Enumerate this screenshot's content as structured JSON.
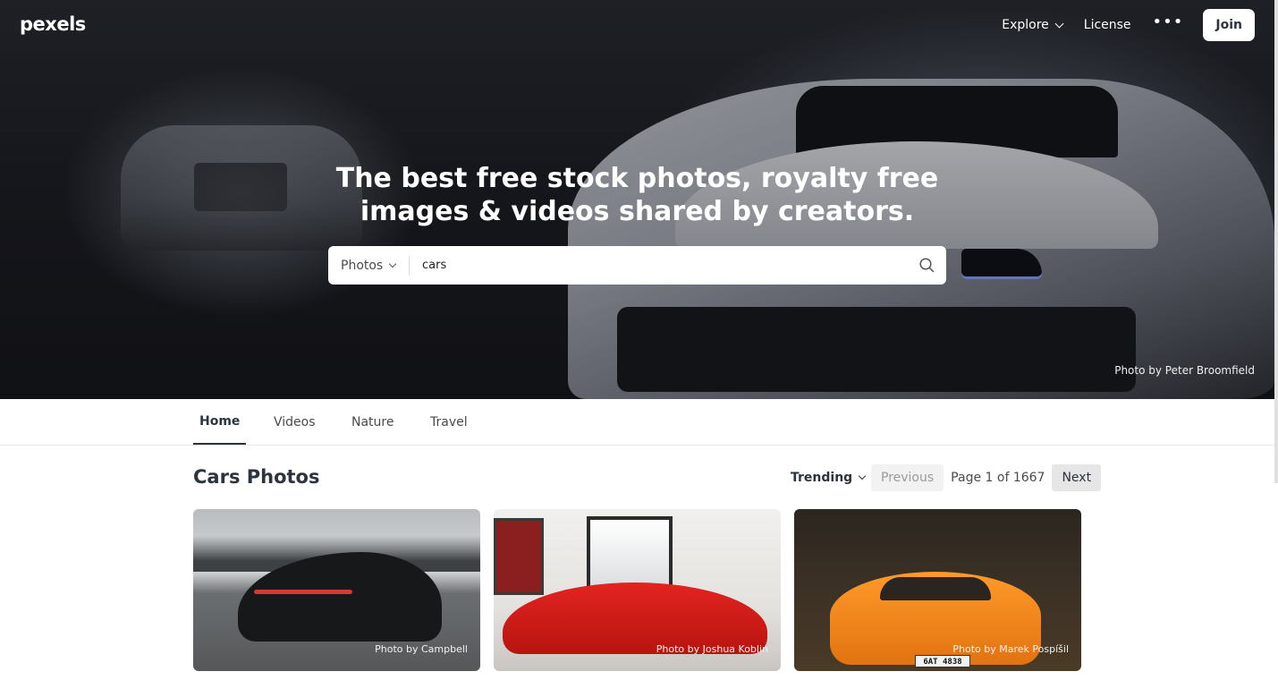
{
  "header": {
    "logo": "pexels",
    "nav": [
      {
        "label": "Explore",
        "has_dropdown": true
      },
      {
        "label": "License",
        "has_dropdown": false
      }
    ],
    "more_label": "•••",
    "join_label": "Join"
  },
  "hero": {
    "headline_line1": "The best free stock photos, royalty free",
    "headline_line2": "images & videos shared by creators.",
    "credit": "Photo by Peter Broomfield"
  },
  "search": {
    "type_label": "Photos",
    "value": "cars",
    "icon": "search-icon"
  },
  "tabs": [
    {
      "label": "Home",
      "active": true
    },
    {
      "label": "Videos",
      "active": false
    },
    {
      "label": "Nature",
      "active": false
    },
    {
      "label": "Travel",
      "active": false
    }
  ],
  "section": {
    "title": "Cars Photos",
    "sort_label": "Trending",
    "previous_label": "Previous",
    "page_text": "Page 1 of 1667",
    "next_label": "Next"
  },
  "photos": [
    {
      "credit": "Photo by Campbell"
    },
    {
      "credit": "Photo by Joshua Koblin"
    },
    {
      "credit": "Photo by Marek Pospíšil",
      "plate": "6AT 4838"
    }
  ],
  "colors": {
    "text_dark": "#2c343e",
    "white": "#ffffff",
    "pager_bg": "#f2f2f2"
  }
}
